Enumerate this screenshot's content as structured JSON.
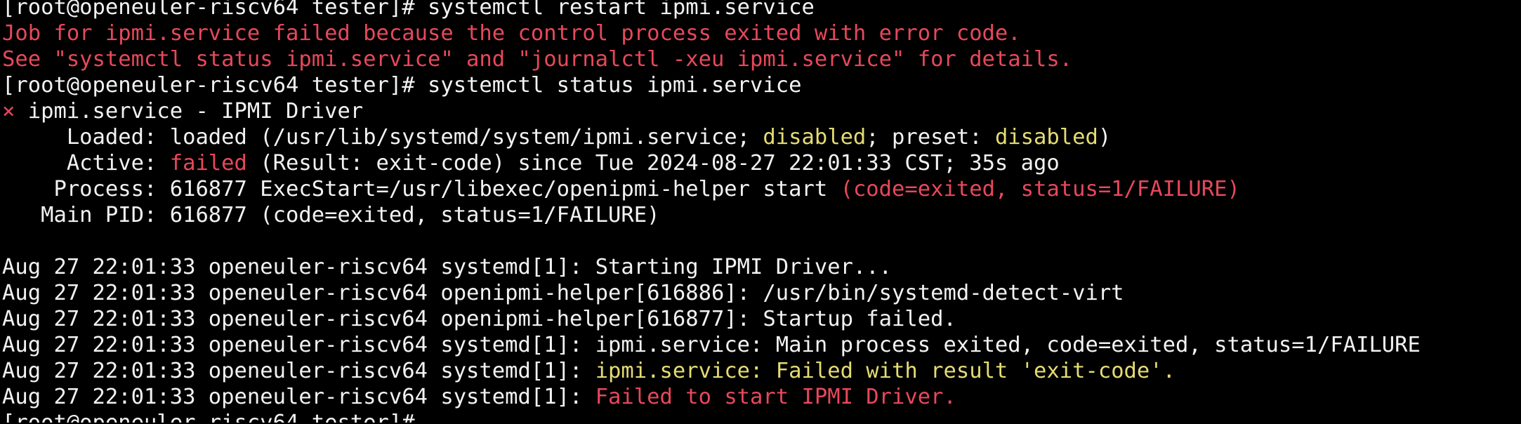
{
  "colors": {
    "background": "#000000",
    "default_text": "#f2f2f2",
    "error_red": "#e7485a",
    "warning_yellow": "#e4dc73"
  },
  "lines": [
    {
      "segments": [
        {
          "t": "[root@openeuler-riscv64 tester]# systemctl restart ipmi.service",
          "c": "w"
        }
      ]
    },
    {
      "segments": [
        {
          "t": "Job for ipmi.service failed because the control process exited with error code.",
          "c": "r"
        }
      ]
    },
    {
      "segments": [
        {
          "t": "See \"systemctl status ipmi.service\" and \"journalctl -xeu ipmi.service\" for details.",
          "c": "r"
        }
      ]
    },
    {
      "segments": [
        {
          "t": "[root@openeuler-riscv64 tester]# systemctl status ipmi.service",
          "c": "w"
        }
      ]
    },
    {
      "segments": [
        {
          "t": "×",
          "c": "r"
        },
        {
          "t": " ipmi.service - IPMI Driver",
          "c": "w"
        }
      ]
    },
    {
      "segments": [
        {
          "t": "     Loaded: loaded (/usr/lib/systemd/system/ipmi.service; ",
          "c": "w"
        },
        {
          "t": "disabled",
          "c": "y"
        },
        {
          "t": "; preset: ",
          "c": "w"
        },
        {
          "t": "disabled",
          "c": "y"
        },
        {
          "t": ")",
          "c": "w"
        }
      ]
    },
    {
      "segments": [
        {
          "t": "     Active: ",
          "c": "w"
        },
        {
          "t": "failed",
          "c": "r"
        },
        {
          "t": " (Result: exit-code) since Tue 2024-08-27 22:01:33 CST; 35s ago",
          "c": "w"
        }
      ]
    },
    {
      "segments": [
        {
          "t": "    Process: 616877 ExecStart=/usr/libexec/openipmi-helper start ",
          "c": "w"
        },
        {
          "t": "(code=exited, status=1/FAILURE)",
          "c": "r"
        }
      ]
    },
    {
      "segments": [
        {
          "t": "   Main PID: 616877 (code=exited, status=1/FAILURE)",
          "c": "w"
        }
      ]
    },
    {
      "segments": [
        {
          "t": "",
          "c": "w"
        }
      ]
    },
    {
      "segments": [
        {
          "t": "Aug 27 22:01:33 openeuler-riscv64 systemd[1]: Starting IPMI Driver...",
          "c": "w"
        }
      ]
    },
    {
      "segments": [
        {
          "t": "Aug 27 22:01:33 openeuler-riscv64 openipmi-helper[616886]: /usr/bin/systemd-detect-virt",
          "c": "w"
        }
      ]
    },
    {
      "segments": [
        {
          "t": "Aug 27 22:01:33 openeuler-riscv64 openipmi-helper[616877]: Startup failed.",
          "c": "w"
        }
      ]
    },
    {
      "segments": [
        {
          "t": "Aug 27 22:01:33 openeuler-riscv64 systemd[1]: ",
          "c": "w"
        },
        {
          "t": "ipmi.service: Main process exited, code=exited, status=1/FAILURE",
          "c": "w"
        }
      ]
    },
    {
      "segments": [
        {
          "t": "Aug 27 22:01:33 openeuler-riscv64 systemd[1]: ",
          "c": "w"
        },
        {
          "t": "ipmi.service: Failed with result 'exit-code'.",
          "c": "y"
        }
      ]
    },
    {
      "segments": [
        {
          "t": "Aug 27 22:01:33 openeuler-riscv64 systemd[1]: ",
          "c": "w"
        },
        {
          "t": "Failed to start IPMI Driver.",
          "c": "r"
        }
      ]
    },
    {
      "segments": [
        {
          "t": "[root@openeuler-riscv64 tester]#",
          "c": "w"
        }
      ]
    }
  ]
}
